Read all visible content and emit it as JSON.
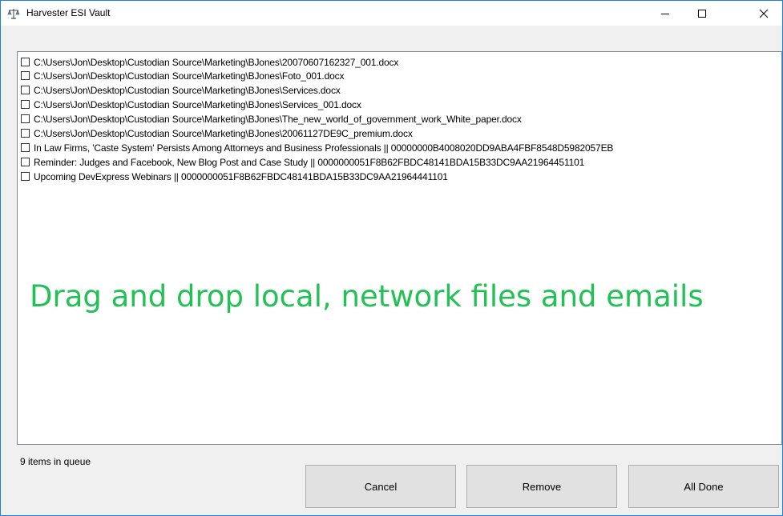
{
  "window": {
    "title": "Harvester ESI Vault",
    "app_icon": "scales-icon",
    "controls": [
      "minimize-icon",
      "maximize-icon",
      "close-icon"
    ]
  },
  "queue": {
    "items": [
      "C:\\Users\\Jon\\Desktop\\Custodian Source\\Marketing\\BJones\\20070607162327_001.docx",
      "C:\\Users\\Jon\\Desktop\\Custodian Source\\Marketing\\BJones\\Foto_001.docx",
      "C:\\Users\\Jon\\Desktop\\Custodian Source\\Marketing\\BJones\\Services.docx",
      "C:\\Users\\Jon\\Desktop\\Custodian Source\\Marketing\\BJones\\Services_001.docx",
      "C:\\Users\\Jon\\Desktop\\Custodian Source\\Marketing\\BJones\\The_new_world_of_government_work_White_paper.docx",
      "C:\\Users\\Jon\\Desktop\\Custodian Source\\Marketing\\BJones\\20061127DE9C_premium.docx",
      "In Law Firms, 'Caste System' Persists Among Attorneys and Business Professionals || 00000000B4008020DD9ABA4FBF8548D5982057EB",
      "Reminder: Judges and Facebook, New Blog Post and Case Study || 0000000051F8B62FBDC48141BDA15B33DC9AA21964451101",
      "Upcoming DevExpress Webinars || 0000000051F8B62FBDC48141BDA15B33DC9AA21964441101"
    ],
    "drop_hint": "Drag and drop local, network files and emails"
  },
  "footer": {
    "status": "9 items in queue",
    "cancel_label": "Cancel",
    "remove_label": "Remove",
    "done_label": "All Done"
  },
  "colors": {
    "drop_hint": "#22c155",
    "window_border": "#1883d7",
    "button_face": "#e1e1e1"
  }
}
